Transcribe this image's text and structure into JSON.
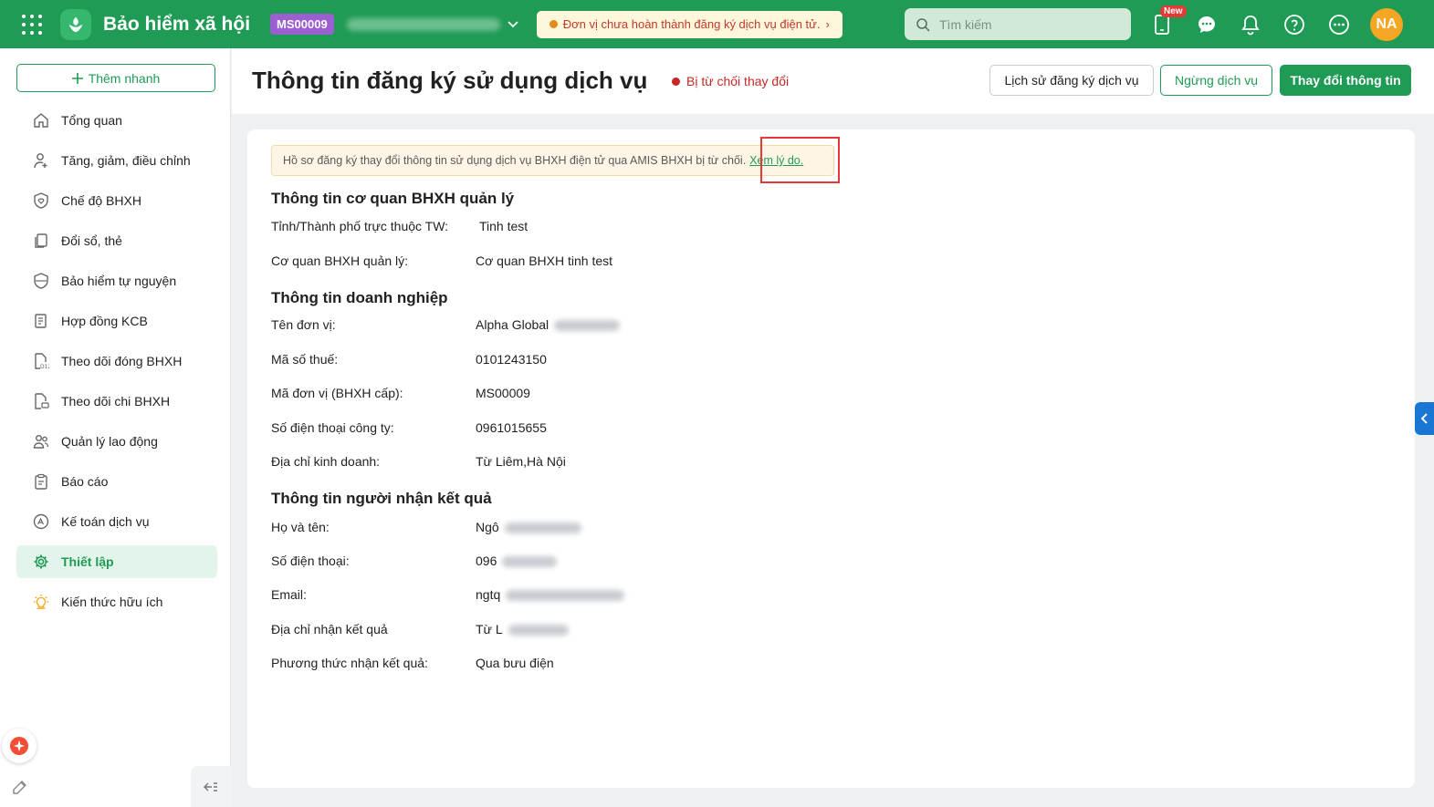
{
  "header": {
    "app_name": "Bảo hiểm xã hội",
    "unit_code": "MS00009",
    "alert_text": "Đơn vị chưa hoàn thành đăng ký dịch vụ điện tử.",
    "alert_arrow": "›",
    "search_placeholder": "Tìm kiếm",
    "new_badge": "New",
    "avatar_initials": "NA",
    "colors": {
      "brand": "#1f9b55",
      "unit_badge": "#9b5fd1",
      "avatar": "#f5a623"
    }
  },
  "sidebar": {
    "quick_add_label": "Thêm nhanh",
    "items": [
      {
        "label": "Tổng quan",
        "icon": "home-icon"
      },
      {
        "label": "Tăng, giảm, điều chỉnh",
        "icon": "user-adjust-icon"
      },
      {
        "label": "Chế độ BHXH",
        "icon": "shield-heart-icon"
      },
      {
        "label": "Đổi sổ, thẻ",
        "icon": "cards-icon"
      },
      {
        "label": "Bảo hiểm tự nguyện",
        "icon": "shield-icon"
      },
      {
        "label": "Hợp đồng KCB",
        "icon": "contract-icon"
      },
      {
        "label": "Theo dõi đóng BHXH",
        "icon": "d12-file-icon"
      },
      {
        "label": "Theo dõi chi BHXH",
        "icon": "money-file-icon"
      },
      {
        "label": "Quản lý lao động",
        "icon": "people-icon"
      },
      {
        "label": "Báo cáo",
        "icon": "report-icon"
      },
      {
        "label": "Kế toán dịch vụ",
        "icon": "accounting-icon"
      },
      {
        "label": "Thiết lập",
        "icon": "gear-icon",
        "active": true
      },
      {
        "label": "Kiến thức hữu ích",
        "icon": "bulb-icon"
      }
    ]
  },
  "page": {
    "title": "Thông tin đăng ký sử dụng dịch vụ",
    "status": "Bị từ chối thay đổi",
    "buttons": {
      "history": "Lịch sử đăng ký dịch vụ",
      "stop": "Ngừng dịch vụ",
      "change": "Thay đổi thông tin"
    },
    "notice_text": "Hồ sơ đăng ký thay đổi thông tin sử dụng dịch vụ BHXH điện tử qua AMIS BHXH bị từ chối.",
    "notice_link": "Xem lý do."
  },
  "sections": {
    "agency": {
      "title": "Thông tin cơ quan BHXH quản lý",
      "province_label": "Tỉnh/Thành phố trực thuộc TW:",
      "province_value": "Tinh test",
      "agency_label": "Cơ quan BHXH quản lý:",
      "agency_value": "Cơ quan BHXH tinh test"
    },
    "company": {
      "title": "Thông tin doanh nghiệp",
      "name_label": "Tên đơn vị:",
      "name_value": "Alpha Global",
      "tax_label": "Mã số thuế:",
      "tax_value": "0101243150",
      "code_label": "Mã đơn vị (BHXH cấp):",
      "code_value": "MS00009",
      "phone_label": "Số điện thoại công ty:",
      "phone_value": "0961015655",
      "address_label": "Địa chỉ kinh doanh:",
      "address_value": "Từ Liêm,Hà Nội"
    },
    "recipient": {
      "title": "Thông tin người nhận kết quả",
      "name_label": "Họ và tên:",
      "name_value": "Ngô",
      "phone_label": "Số điện thoại:",
      "phone_value": "096",
      "email_label": "Email:",
      "email_value": "ngtq",
      "address_label": "Địa chỉ nhận kết quả",
      "address_value": "Từ L",
      "method_label": "Phương thức nhận kết quả:",
      "method_value": "Qua bưu điện"
    }
  }
}
